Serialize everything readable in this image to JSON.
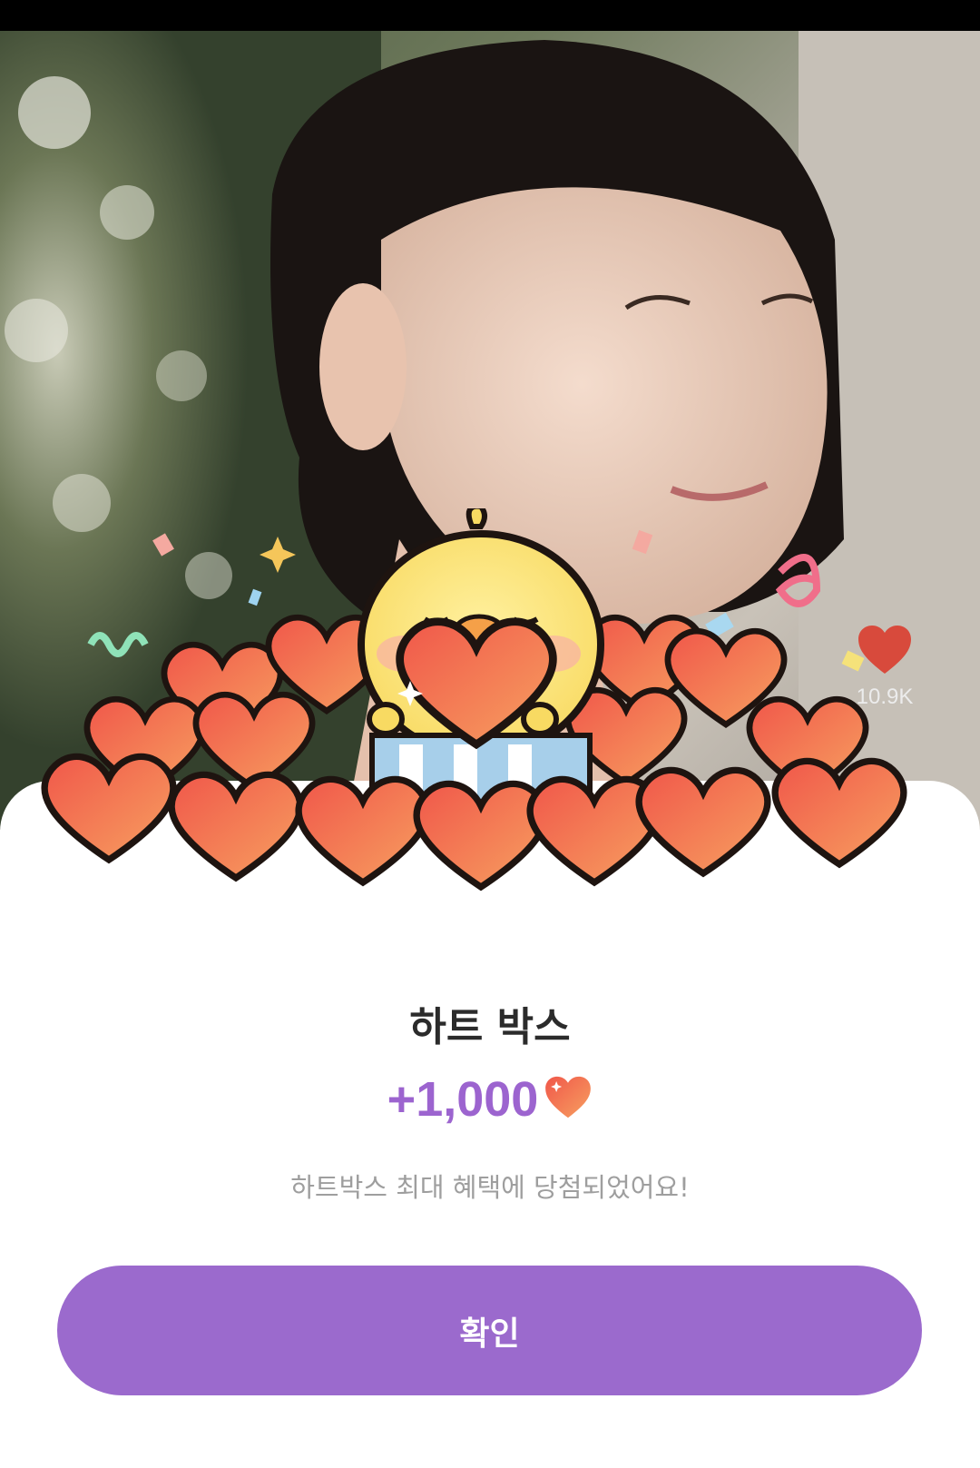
{
  "background": {
    "like_count": "10.9K"
  },
  "reward_popup": {
    "title": "하트 박스",
    "amount": "+1,000",
    "message": "하트박스 최대 혜택에 당첨되었어요!",
    "confirm_label": "확인"
  },
  "colors": {
    "accent": "#9b6acd",
    "reward_text": "#9c64cf",
    "heart": "#f06e52"
  },
  "icons": {
    "illustration": "chick-with-hearts-illustration",
    "reward_heart": "heart-icon",
    "like": "heart-icon"
  }
}
